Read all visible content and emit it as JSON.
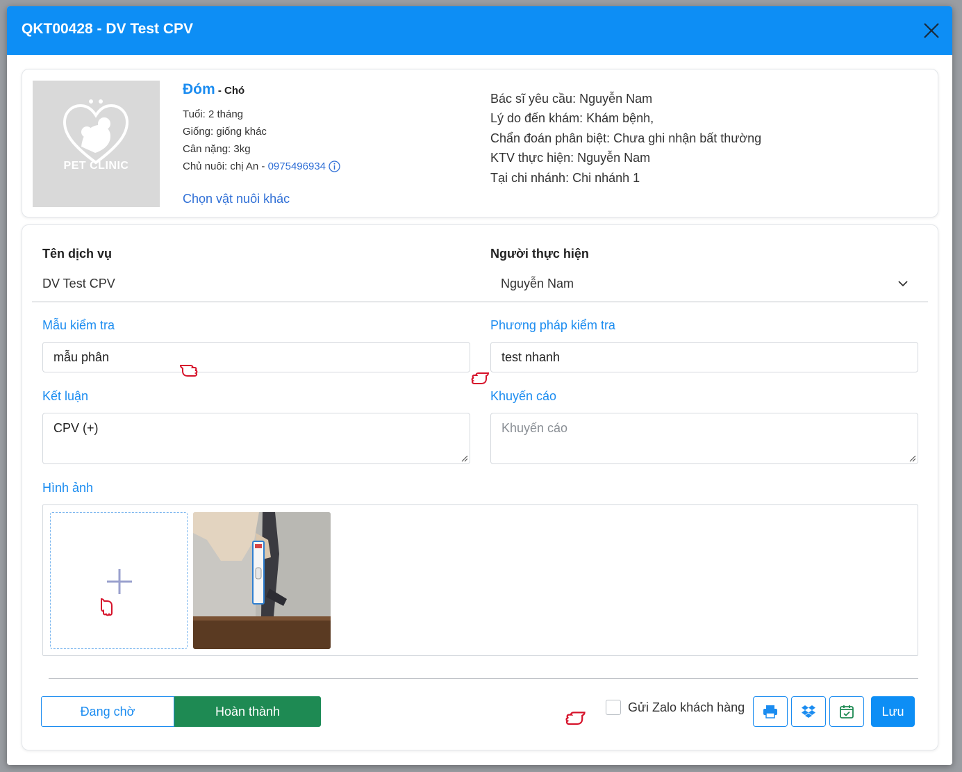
{
  "modal": {
    "title": "QKT00428 - DV Test CPV"
  },
  "pet": {
    "logo_text": "PET CLINIC",
    "name": "Đóm",
    "species": " - Chó",
    "age": "Tuổi: 2 tháng",
    "breed": "Giống: giống khác",
    "weight": "Cân nặng: 3kg",
    "owner_prefix": "Chủ nuôi: chị An - ",
    "owner_phone": "0975496934",
    "choose_other": "Chọn vật nuôi khác"
  },
  "visit": {
    "doctor": "Bác sĩ yêu cầu: Nguyễn Nam",
    "reason": "Lý do đến khám: Khám bệnh,",
    "diagnosis": "Chẩn đoán phân biệt: Chưa ghi nhận bất thường",
    "technician": "KTV thực hiện: Nguyễn Nam",
    "branch": "Tại chi nhánh: Chi nhánh 1"
  },
  "form": {
    "service_label": "Tên dịch vụ",
    "service_value": "DV Test CPV",
    "performer_label": "Người thực hiện",
    "performer_value": "Nguyễn Nam",
    "sample_label": "Mẫu kiểm tra",
    "sample_value": "mẫu phân",
    "method_label": "Phương pháp kiểm tra",
    "method_value": "test nhanh",
    "conclusion_label": "Kết luận",
    "conclusion_value": "CPV (+)",
    "advice_label": "Khuyến cáo",
    "advice_placeholder": "Khuyến cáo",
    "images_label": "Hình ảnh"
  },
  "actions": {
    "pending_label": "Đang chờ",
    "done_label": "Hoàn thành",
    "zalo_label": "Gửi Zalo khách hàng",
    "save_label": "Lưu"
  },
  "colors": {
    "header": "#0d8ef5",
    "accent": "#1b8cf0",
    "done": "#1e8a53",
    "pointer_hand": "#d6132b"
  },
  "icons": [
    "close-icon",
    "info-icon",
    "chevron-down-icon",
    "plus-icon",
    "print-icon",
    "dropbox-icon",
    "calendar-icon",
    "pointing-hand-icon"
  ]
}
